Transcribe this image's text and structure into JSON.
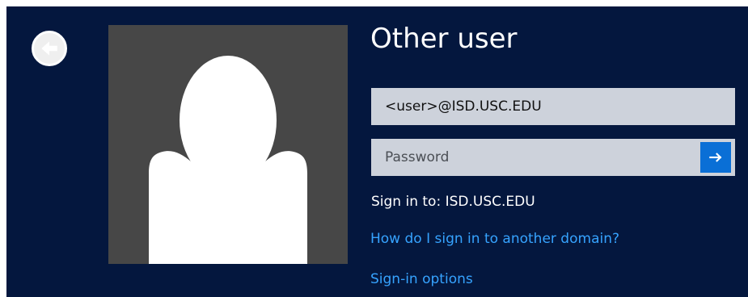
{
  "colors": {
    "background": "#04173e",
    "field_background": "#cdd2db",
    "submit_button": "#0a6fd6",
    "link": "#36a3ff",
    "avatar_background": "#474747"
  },
  "navigation": {
    "back_icon": "arrow-left-icon"
  },
  "avatar": {
    "icon": "default-user-icon"
  },
  "sign_in": {
    "title": "Other user",
    "username_value": "<user>@ISD.USC.EDU",
    "password_placeholder": "Password",
    "submit_icon": "arrow-right-icon",
    "sign_in_to_text": "Sign in to: ISD.USC.EDU",
    "domain_help_link": "How do I sign in to another domain?",
    "options_link": "Sign-in options"
  }
}
